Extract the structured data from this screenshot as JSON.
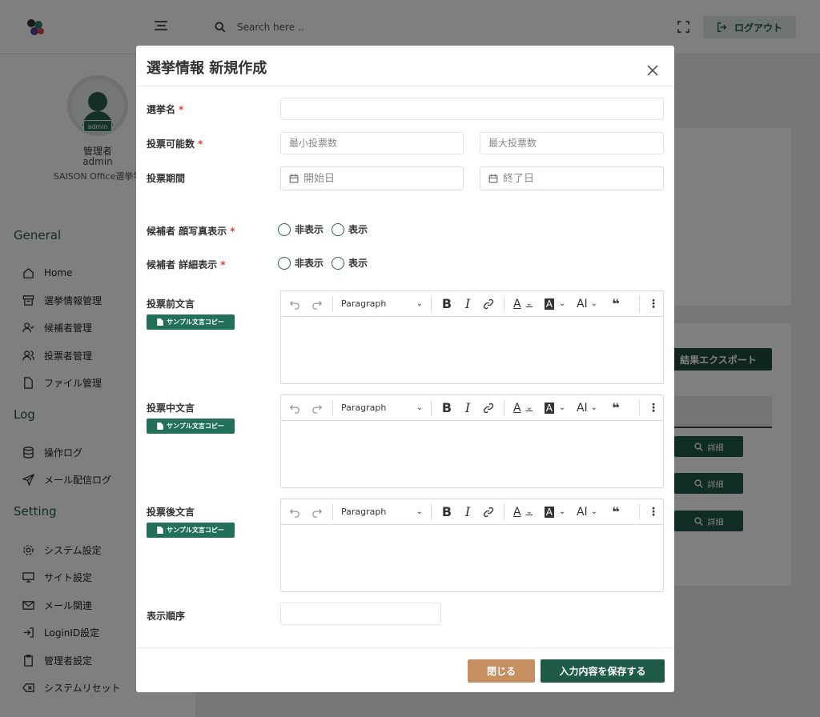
{
  "header": {
    "search_placeholder": "Search here ..",
    "logout_label": "ログアウト"
  },
  "sidebar": {
    "badge": "admin",
    "user_role": "管理者",
    "user_id": "admin",
    "user_org": "SAISON Office選挙学",
    "sections": {
      "general": "General",
      "log": "Log",
      "setting": "Setting"
    },
    "items": [
      {
        "label": "Home",
        "icon": "home-icon"
      },
      {
        "label": "選挙情報管理",
        "icon": "archive-icon"
      },
      {
        "label": "候補者管理",
        "icon": "user-check-icon"
      },
      {
        "label": "投票者管理",
        "icon": "users-icon"
      },
      {
        "label": "ファイル管理",
        "icon": "file-icon"
      },
      {
        "label": "操作ログ",
        "icon": "database-icon"
      },
      {
        "label": "メール配信ログ",
        "icon": "send-icon"
      },
      {
        "label": "システム設定",
        "icon": "settings-icon"
      },
      {
        "label": "サイト設定",
        "icon": "monitor-icon"
      },
      {
        "label": "メール関連",
        "icon": "mail-icon"
      },
      {
        "label": "LoginID設定",
        "icon": "login-icon"
      },
      {
        "label": "管理者設定",
        "icon": "clipboard-icon"
      },
      {
        "label": "システムリセット",
        "icon": "delete-icon"
      }
    ]
  },
  "background": {
    "export_label": "結果エクスポート",
    "detail_label": "詳細"
  },
  "modal": {
    "title": "選挙情報 新規作成",
    "fields": {
      "election_name_label": "選挙名",
      "vote_count_label": "投票可能数",
      "min_votes_placeholder": "最小投票数",
      "max_votes_placeholder": "最大投票数",
      "period_label": "投票期間",
      "start_date_placeholder": "開始日",
      "end_date_placeholder": "終了日",
      "photo_display_label": "候補者 顔写真表示",
      "detail_display_label": "候補者 詳細表示",
      "option_hide": "非表示",
      "option_show": "表示",
      "pre_vote_label": "投票前文言",
      "mid_vote_label": "投票中文言",
      "post_vote_label": "投票後文言",
      "sample_copy_label": "サンプル文言コピー",
      "display_order_label": "表示順序"
    },
    "editor": {
      "paragraph": "Paragraph",
      "bold": "B",
      "italic": "I",
      "font_color": "A",
      "highlight": "A",
      "text_size": "AI",
      "quote": "❝"
    },
    "required_mark": "*",
    "close_button": "閉じる",
    "save_button": "入力内容を保存する"
  }
}
